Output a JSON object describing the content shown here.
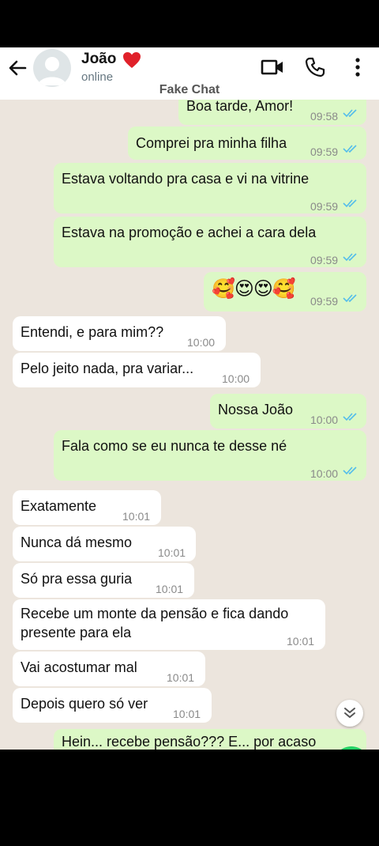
{
  "header": {
    "contact_name": "João",
    "status": "online",
    "watermark": "Fake Chat"
  },
  "messages": [
    {
      "text": "Boa tarde, Amor!",
      "time": "09:58",
      "dir": "out"
    },
    {
      "text": "Comprei pra minha filha",
      "time": "09:59",
      "dir": "out"
    },
    {
      "text": "Estava voltando pra casa e vi na vitrine",
      "time": "09:59",
      "dir": "out"
    },
    {
      "text": "Estava na promoção e achei a cara dela",
      "time": "09:59",
      "dir": "out"
    },
    {
      "text": "🥰😍😍🥰",
      "time": "09:59",
      "dir": "out"
    },
    {
      "text": "Entendi, e para mim??",
      "time": "10:00",
      "dir": "in"
    },
    {
      "text": "Pelo jeito nada, pra variar...",
      "time": "10:00",
      "dir": "in"
    },
    {
      "text": "Nossa João",
      "time": "10:00",
      "dir": "out"
    },
    {
      "text": "Fala como se eu nunca te desse né",
      "time": "10:00",
      "dir": "out"
    },
    {
      "text": "Exatamente",
      "time": "10:01",
      "dir": "in"
    },
    {
      "text": "Nunca dá mesmo",
      "time": "10:01",
      "dir": "in"
    },
    {
      "text": "Só pra essa guria",
      "time": "10:01",
      "dir": "in"
    },
    {
      "text": "Recebe um monte da pensão e fica dando presente para ela",
      "line1": "Recebe um monte da pensão e fica dando",
      "line2": "presente para ela",
      "time": "10:01",
      "dir": "in"
    },
    {
      "text": "Vai acostumar mal",
      "time": "10:01",
      "dir": "in"
    },
    {
      "text": "Depois quero só ver",
      "time": "10:01",
      "dir": "in"
    }
  ],
  "partial_message": {
    "text": "Hein... recebe pensão??? E... por acaso"
  },
  "colors": {
    "outgoing": "#dcf8c6",
    "incoming": "#ffffff",
    "ticks": "#53bdeb",
    "background": "#ece5dd"
  }
}
